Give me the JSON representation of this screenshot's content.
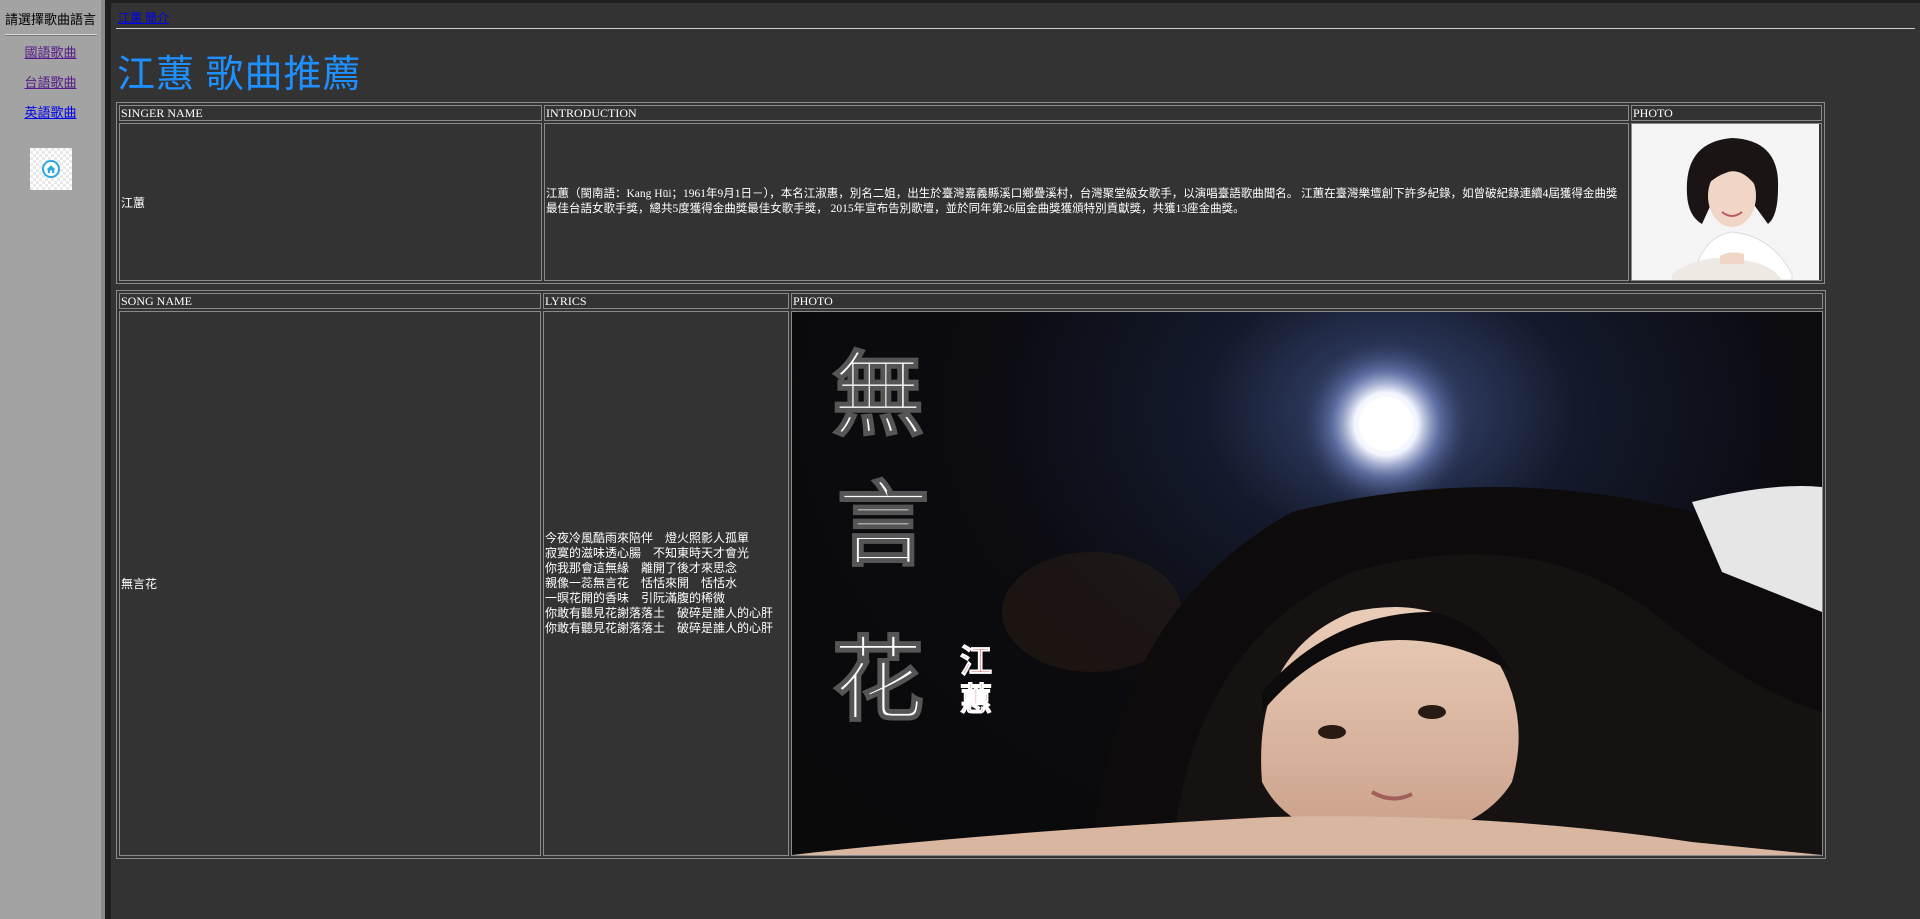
{
  "sidebar": {
    "title": "請選擇歌曲語言",
    "links": [
      {
        "label": "國語歌曲"
      },
      {
        "label": "台語歌曲"
      },
      {
        "label": "英語歌曲"
      }
    ],
    "home_icon": "home-icon"
  },
  "main": {
    "breadcrumb": "江蕙 簡介",
    "title": "江蕙 歌曲推薦",
    "singer_table": {
      "headers": [
        "SINGER NAME",
        "INTRODUCTION",
        "PHOTO"
      ],
      "singer_name": "江蕙",
      "introduction": "江蕙（閩南語：Kang Hūi；1961年9月1日－），本名江淑惠，別名二姐，出生於臺灣嘉義縣溪口鄉疊溪村，台灣聚堂級女歌手，以演唱臺語歌曲聞名。 江蕙在臺灣樂壇創下許多紀錄，如曾破紀錄連續4屆獲得金曲獎最佳台語女歌手獎，總共5度獲得金曲獎最佳女歌手獎， 2015年宣布告別歌壇，並於同年第26屆金曲獎獲頒特別貢獻獎，共獲13座金曲獎。",
      "photo": "singer-portrait"
    },
    "song_table": {
      "headers": [
        "SONG NAME",
        "LYRICS",
        "PHOTO"
      ],
      "song_name": "無言花",
      "lyrics": [
        "今夜冷風酷雨來陪伴　燈火照影人孤單",
        "寂寞的滋味透心腸　不知東時天才會光",
        "你我那會這無緣　離開了後才來思念",
        "親像一蕊無言花　恬恬來開　恬恬水",
        "一暝花開的香味　引阮滿腹的稀微",
        "你敢有聽見花謝落落土　破碎是誰人的心肝",
        "你敢有聽見花謝落落土　破碎是誰人的心肝"
      ],
      "poster_title_chars": [
        "無",
        "言",
        "花"
      ],
      "poster_artist_chars": [
        "江",
        "蕙"
      ]
    }
  }
}
